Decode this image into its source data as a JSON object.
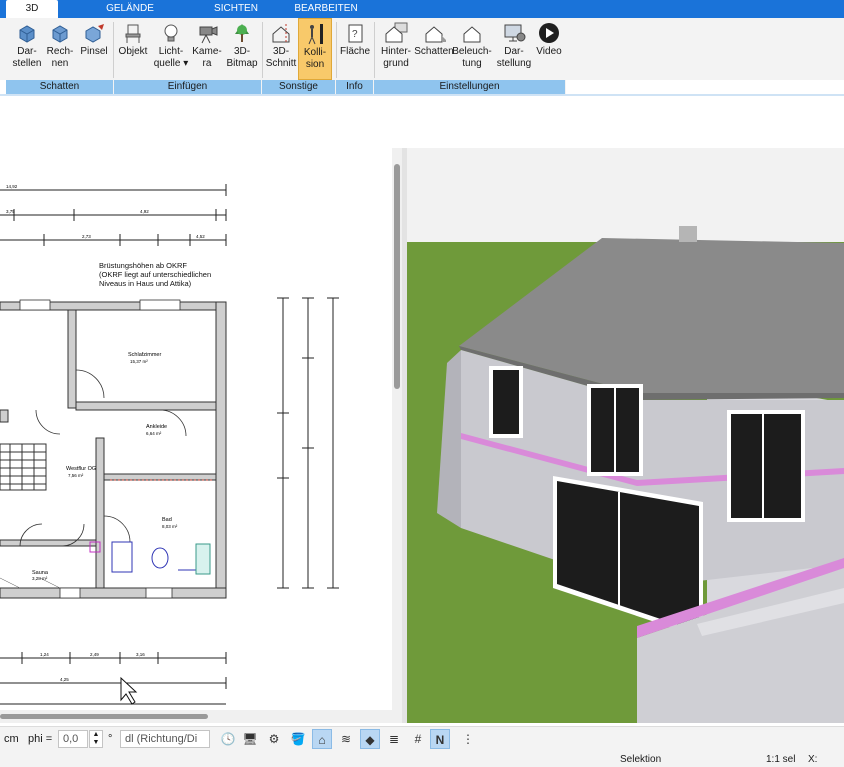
{
  "tabs": [
    {
      "label": "3D",
      "active": true
    },
    {
      "label": "GELÄNDE"
    },
    {
      "label": "SICHTEN"
    },
    {
      "label": "BEARBEITEN"
    }
  ],
  "ribbon": {
    "buttons": [
      {
        "label": "Dar-\nstellen",
        "icon": "display-icon"
      },
      {
        "label": "Rech-\nnen",
        "icon": "compute-icon"
      },
      {
        "label": "Pinsel",
        "icon": "brush-icon"
      },
      {
        "label": "Objekt",
        "icon": "chair-icon"
      },
      {
        "label": "Licht-\nquelle ▾",
        "icon": "lightbulb-icon"
      },
      {
        "label": "Kame-\nra",
        "icon": "camera-icon"
      },
      {
        "label": "3D-\nBitmap",
        "icon": "tree-icon"
      },
      {
        "label": "3D-\nSchnitt",
        "icon": "section-cut-icon"
      },
      {
        "label": "Kolli-\nsion",
        "icon": "collision-icon",
        "active": true
      },
      {
        "label": "Fläche",
        "icon": "area-info-icon"
      },
      {
        "label": "Hinter-\ngrund",
        "icon": "background-house-icon"
      },
      {
        "label": "Schatten",
        "icon": "shadow-house-icon"
      },
      {
        "label": "Beleuch-\ntung",
        "icon": "lighting-house-icon"
      },
      {
        "label": "Dar-\nstellung",
        "icon": "display-settings-icon"
      },
      {
        "label": "Video",
        "icon": "video-play-icon"
      }
    ],
    "groups": [
      "Schatten",
      "Einfügen",
      "Sonstige",
      "Info",
      "Einstellungen"
    ]
  },
  "plan": {
    "note_lines": [
      "Brüstungshöhen ab OKRF",
      "(OKRF liegt auf unterschiedlichen",
      "Niveaus in Haus und Attika)"
    ],
    "rooms": [
      {
        "name": "Schlafzimmer",
        "area": "15,37 m²"
      },
      {
        "name": "Ankleide",
        "area": "6,64 m²"
      },
      {
        "name": "Westflur OG",
        "area": "7,56 m²"
      },
      {
        "name": "Bad",
        "area": "8,03 m²"
      },
      {
        "name": "Sauna",
        "area": "3,28 m²"
      }
    ],
    "dims_top": [
      "14,92",
      "3,75",
      "4,92",
      "2,73",
      "4,52"
    ],
    "dims_bottom": [
      "1,24",
      "2,49",
      "3,16",
      "4,25"
    ]
  },
  "toolbar": {
    "unit": "cm",
    "phi_label": "phi =",
    "phi_value": "0,0",
    "degree": "°",
    "direction": "dl (Richtung/Di",
    "tools": [
      {
        "icon": "clock-icon",
        "glyph": "🕓"
      },
      {
        "icon": "monitor-icon",
        "glyph": "🖥"
      },
      {
        "icon": "gear-network-icon",
        "glyph": "⚙"
      },
      {
        "icon": "paint-bucket-icon",
        "glyph": "🪣"
      },
      {
        "icon": "roof-tool-icon",
        "glyph": "⌂",
        "active": true
      },
      {
        "icon": "walls-tool-icon",
        "glyph": "≋"
      },
      {
        "icon": "floor-tool-icon",
        "glyph": "◆",
        "active": true
      },
      {
        "icon": "layers-icon",
        "glyph": "≣"
      },
      {
        "icon": "grid-icon",
        "glyph": "#"
      },
      {
        "icon": "north-icon",
        "glyph": "N",
        "active": true
      },
      {
        "icon": "more-icon",
        "glyph": "⋮"
      }
    ]
  },
  "status": {
    "mode": "Selektion",
    "scale": "1:1 sel",
    "coord_label": "X:"
  },
  "colors": {
    "accent": "#1a73d9",
    "group_bar": "#8fc4ee",
    "active_button": "#f8c96a",
    "grass": "#6f9a3a",
    "roof": "#8a8a8a"
  }
}
